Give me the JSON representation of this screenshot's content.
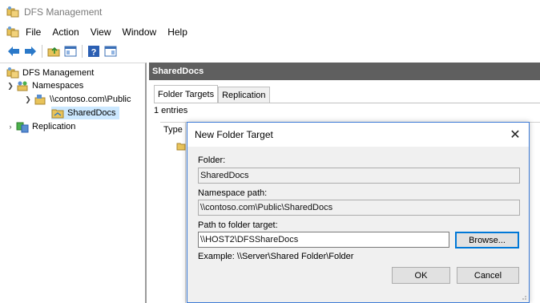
{
  "window": {
    "title": "DFS Management"
  },
  "menu": {
    "items": [
      "File",
      "Action",
      "View",
      "Window",
      "Help"
    ]
  },
  "toolbar": {
    "icons": [
      "back-arrow-icon",
      "forward-arrow-icon",
      "up-folder-icon",
      "show-hide-console-tree-icon",
      "help-icon",
      "show-action-pane-icon"
    ]
  },
  "tree": {
    "root": "DFS Management",
    "namespaces": "Namespaces",
    "namespace": "\\\\contoso.com\\Public",
    "folder": "SharedDocs",
    "replication": "Replication"
  },
  "details": {
    "header": "SharedDocs",
    "tabs": [
      "Folder Targets",
      "Replication"
    ],
    "entries": "1 entries",
    "column_type": "Type"
  },
  "dialog": {
    "title": "New Folder Target",
    "close_glyph": "✕",
    "folder_label": "Folder:",
    "folder_value": "SharedDocs",
    "namespace_path_label": "Namespace path:",
    "namespace_path_value": "\\\\contoso.com\\Public\\SharedDocs",
    "target_label": "Path to folder target:",
    "target_value": "\\\\HOST2\\DFSShareDocs",
    "browse_label": "Browse...",
    "example": "Example: \\\\Server\\Shared Folder\\Folder",
    "ok_label": "OK",
    "cancel_label": "Cancel"
  },
  "colors": {
    "header_bg": "#5f5f5f",
    "selection_bg": "#cce8ff",
    "dialog_border": "#3d7bd6",
    "focus_blue": "#0078d7"
  }
}
